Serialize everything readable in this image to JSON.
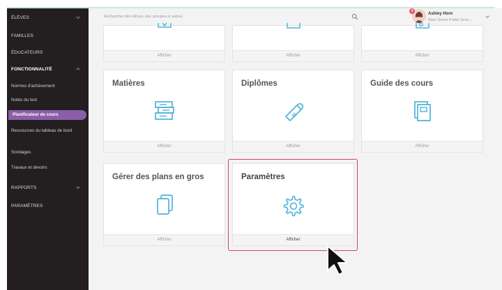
{
  "sidebar": {
    "items": [
      {
        "label": "ÉLÈVES"
      },
      {
        "label": "FAMILLES"
      },
      {
        "label": "ÉDUCATEURS"
      },
      {
        "label": "FONCTIONNALITÉ"
      },
      {
        "label": "RAPPORTS"
      },
      {
        "label": "PARAMÈTRES"
      }
    ],
    "sub_items": [
      {
        "label": "Normes d'achèvement"
      },
      {
        "label": "Notes du test"
      },
      {
        "label": "Planificateur de cours"
      },
      {
        "label": "Ressources du tableau de bord"
      },
      {
        "label": "Sondages"
      },
      {
        "label": "Travaux et devoirs"
      }
    ]
  },
  "search": {
    "placeholder": "Rechercher des élèves, des groupes et autres"
  },
  "user": {
    "name": "Ashley Horn",
    "school": "Main Street Public Scho...",
    "badge": "3"
  },
  "cards": {
    "top_row": [
      {
        "action": "Afficher"
      },
      {
        "action": "Afficher"
      },
      {
        "action": "Afficher"
      }
    ],
    "row2": [
      {
        "title": "Matières",
        "action": "Afficher",
        "icon": "books-stack-icon"
      },
      {
        "title": "Diplômes",
        "action": "Afficher",
        "icon": "diploma-scroll-icon"
      },
      {
        "title": "Guide des cours",
        "action": "Afficher",
        "icon": "guide-book-icon"
      }
    ],
    "row3": [
      {
        "title": "Gérer des plans en gros",
        "action": "Afficher",
        "icon": "documents-icon"
      },
      {
        "title": "Paramètres",
        "action": "Afficher",
        "icon": "gear-icon"
      }
    ]
  },
  "colors": {
    "accent": "#8b5ea8",
    "highlight": "#c94a5c",
    "icon": "#4fb3d9",
    "sidebar": "#231f20"
  }
}
